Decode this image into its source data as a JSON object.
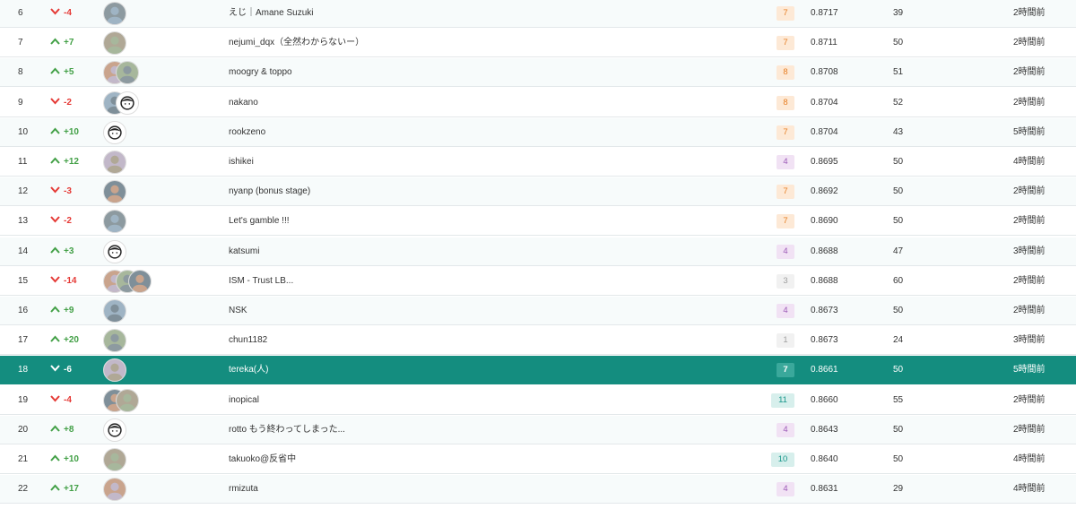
{
  "leaderboard": {
    "rows": [
      {
        "rank": "6",
        "delta": "-4",
        "direction": "down",
        "team": "えじ｜Amane Suzuki",
        "subs": "7",
        "subs_color": "orange",
        "score": "0.8717",
        "entries": "39",
        "last": "2時間前",
        "avatars": [
          "photo-avatar"
        ]
      },
      {
        "rank": "7",
        "delta": "+7",
        "direction": "up",
        "team": "nejumi_dqx（全然わからないー）",
        "subs": "7",
        "subs_color": "orange",
        "score": "0.8711",
        "entries": "50",
        "last": "2時間前",
        "avatars": [
          "photo-avatar"
        ]
      },
      {
        "rank": "8",
        "delta": "+5",
        "direction": "up",
        "team": "moogry & toppo",
        "subs": "8",
        "subs_color": "orange",
        "score": "0.8708",
        "entries": "51",
        "last": "2時間前",
        "avatars": [
          "photo-avatar",
          "photo-avatar"
        ]
      },
      {
        "rank": "9",
        "delta": "-2",
        "direction": "down",
        "team": "nakano",
        "subs": "8",
        "subs_color": "orange",
        "score": "0.8704",
        "entries": "52",
        "last": "2時間前",
        "avatars": [
          "photo-avatar",
          "default-avatar"
        ]
      },
      {
        "rank": "10",
        "delta": "+10",
        "direction": "up",
        "team": "rookzeno",
        "subs": "7",
        "subs_color": "orange",
        "score": "0.8704",
        "entries": "43",
        "last": "5時間前",
        "avatars": [
          "default-avatar"
        ]
      },
      {
        "rank": "11",
        "delta": "+12",
        "direction": "up",
        "team": "ishikei",
        "subs": "4",
        "subs_color": "purple",
        "score": "0.8695",
        "entries": "50",
        "last": "4時間前",
        "avatars": [
          "photo-avatar"
        ]
      },
      {
        "rank": "12",
        "delta": "-3",
        "direction": "down",
        "team": "nyanp (bonus stage)",
        "subs": "7",
        "subs_color": "orange",
        "score": "0.8692",
        "entries": "50",
        "last": "2時間前",
        "avatars": [
          "photo-avatar"
        ]
      },
      {
        "rank": "13",
        "delta": "-2",
        "direction": "down",
        "team": "Let's gamble !!!",
        "subs": "7",
        "subs_color": "orange",
        "score": "0.8690",
        "entries": "50",
        "last": "2時間前",
        "avatars": [
          "photo-avatar"
        ]
      },
      {
        "rank": "14",
        "delta": "+3",
        "direction": "up",
        "team": "katsumi",
        "subs": "4",
        "subs_color": "purple",
        "score": "0.8688",
        "entries": "47",
        "last": "3時間前",
        "avatars": [
          "default-avatar"
        ]
      },
      {
        "rank": "15",
        "delta": "-14",
        "direction": "down",
        "team": "ISM - Trust LB...",
        "subs": "3",
        "subs_color": "grey",
        "score": "0.8688",
        "entries": "60",
        "last": "2時間前",
        "avatars": [
          "photo-avatar",
          "photo-avatar",
          "photo-avatar"
        ]
      },
      {
        "rank": "16",
        "delta": "+9",
        "direction": "up",
        "team": "NSK",
        "subs": "4",
        "subs_color": "purple",
        "score": "0.8673",
        "entries": "50",
        "last": "2時間前",
        "avatars": [
          "photo-avatar"
        ]
      },
      {
        "rank": "17",
        "delta": "+20",
        "direction": "up",
        "team": "chun1182",
        "subs": "1",
        "subs_color": "grey",
        "score": "0.8673",
        "entries": "24",
        "last": "3時間前",
        "avatars": [
          "photo-avatar"
        ]
      },
      {
        "rank": "18",
        "delta": "-6",
        "direction": "down",
        "team": "tereka(人)",
        "subs": "7",
        "subs_color": "sel",
        "score": "0.8661",
        "entries": "50",
        "last": "5時間前",
        "avatars": [
          "photo-avatar"
        ],
        "selected": true
      },
      {
        "rank": "19",
        "delta": "-4",
        "direction": "down",
        "team": "inopical",
        "subs": "11",
        "subs_color": "teal",
        "score": "0.8660",
        "entries": "55",
        "last": "2時間前",
        "avatars": [
          "photo-avatar",
          "photo-avatar"
        ]
      },
      {
        "rank": "20",
        "delta": "+8",
        "direction": "up",
        "team": "rotto もう終わってしまった...",
        "subs": "4",
        "subs_color": "purple",
        "score": "0.8643",
        "entries": "50",
        "last": "2時間前",
        "avatars": [
          "default-avatar"
        ]
      },
      {
        "rank": "21",
        "delta": "+10",
        "direction": "up",
        "team": "takuoko@反省中",
        "subs": "10",
        "subs_color": "teal",
        "score": "0.8640",
        "entries": "50",
        "last": "4時間前",
        "avatars": [
          "photo-avatar"
        ]
      },
      {
        "rank": "22",
        "delta": "+17",
        "direction": "up",
        "team": "rmizuta",
        "subs": "4",
        "subs_color": "purple",
        "score": "0.8631",
        "entries": "29",
        "last": "4時間前",
        "avatars": [
          "photo-avatar"
        ]
      }
    ]
  },
  "colors": {
    "up": "#43a047",
    "down": "#e53935",
    "selected_row": "#148d7f",
    "border": "#e3e8ea"
  }
}
